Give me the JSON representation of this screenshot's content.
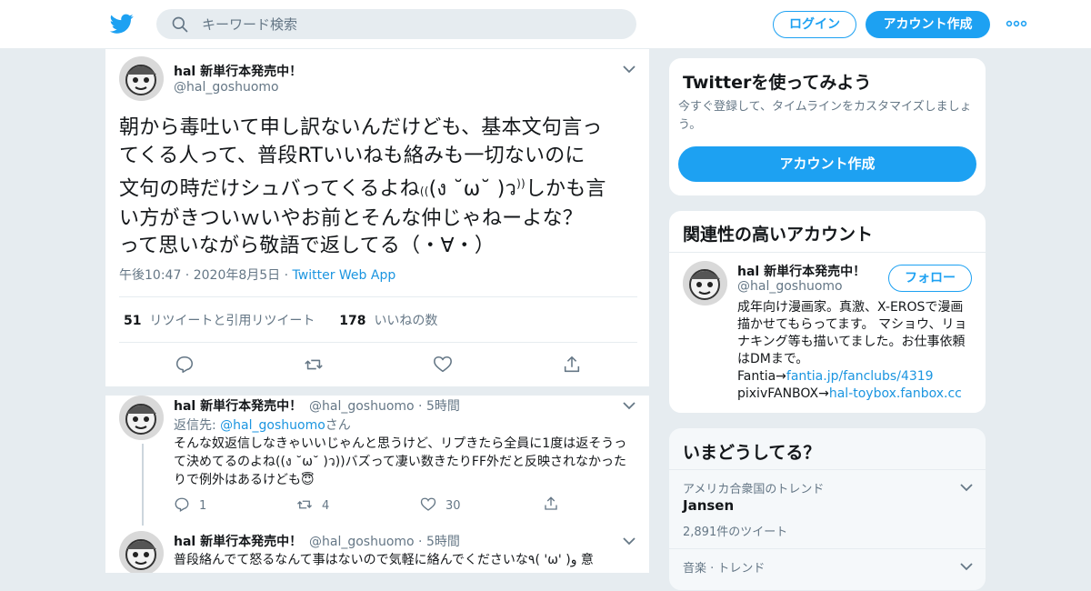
{
  "header": {
    "search_placeholder": "キーワード検索",
    "login_label": "ログイン",
    "signup_label": "アカウント作成",
    "icons": [
      "twitter-bird-icon",
      "search-icon",
      "more-icon"
    ]
  },
  "tweet": {
    "name": "hal 新単行本発売中！",
    "handle": "@hal_goshuomo",
    "text_lines": [
      "朝から毒吐いて申し訳ないんだけども、基本文句言っ",
      "てくる人って、普段RTいいねも絡みも一切ないのに",
      "文句の時だけシュバってくるよね",
      "(ง ˘ω˘ )ว",
      "しかも言",
      "い方がきついｗいやお前とそんな仲じゃねーよな？",
      "って思いながら敬語で返してる（・∀・）"
    ],
    "paren_left": "((",
    "paren_right": "))",
    "time": "午後10:47",
    "date": "2020年8月5日",
    "source": "Twitter Web App",
    "retweets_count": "51",
    "retweets_label": "リツイートと引用リツイート",
    "likes_count": "178",
    "likes_label": "いいねの数"
  },
  "replies": [
    {
      "name": "hal 新単行本発売中！",
      "handle": "@hal_goshuomo",
      "age": "5時間",
      "reply_to_prefix": "返信先: ",
      "reply_to_handle": "@hal_goshuomo",
      "reply_to_suffix": "さん",
      "text": "そんな奴返信しなきゃいいじゃんと思うけど、リプきたら全員に1度は返そうって決めてるのよね((ง ˘ω˘ )ว))バズって凄い数きたりFF外だと反映されなかったりで例外はあるけども😇",
      "replies": "1",
      "retweets": "4",
      "likes": "30"
    },
    {
      "name": "hal 新単行本発売中！",
      "handle": "@hal_goshuomo",
      "age": "5時間",
      "text": "普段絡んでて怒るなんて事はないので気軽に絡んでくださいな٩( 'ω' )و 意"
    }
  ],
  "sidebar": {
    "try_card": {
      "title": "Twitterを使ってみよう",
      "subtitle": "今すぐ登録して、タイムラインをカスタマイズしましょう。",
      "button": "アカウント作成"
    },
    "related": {
      "title": "関連性の高いアカウント",
      "name": "hal 新単行本発売中！",
      "handle": "@hal_goshuomo",
      "follow": "フォロー",
      "bio": "成年向け漫画家。真激、X-EROSで漫画描かせてもらってます。 マショウ、リョナキング等も描いてました。お仕事依頼はDMまで。",
      "fantia_label": "Fantia→",
      "fantia_link": "fantia.jp/fanclubs/4319",
      "pixiv_label": "pixivFANBOX→",
      "pixiv_link": "hal-toybox.fanbox.cc"
    },
    "trends": {
      "title": "いまどうしてる？",
      "items": [
        {
          "category": "アメリカ合衆国のトレンド",
          "name": "Jansen",
          "count": "2,891件のツイート"
        },
        {
          "category": "音楽 · トレンド"
        }
      ]
    }
  },
  "colors": {
    "accent": "#1da1f2",
    "link": "#1b95e0",
    "muted": "#657786",
    "bg": "#e6ecf0"
  }
}
